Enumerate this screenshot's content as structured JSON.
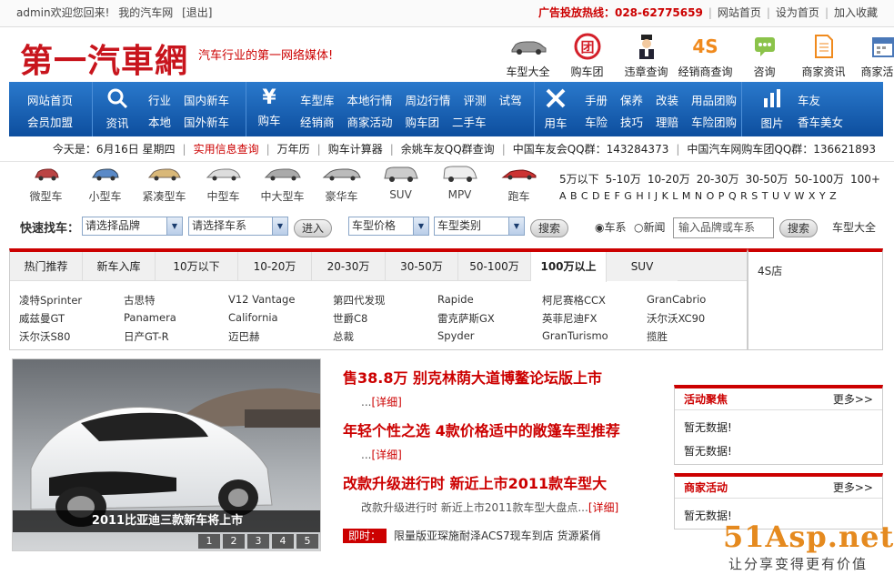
{
  "topbar": {
    "welcome": "admin欢迎您回来!",
    "my_site": "我的汽车网",
    "logout": "[退出]",
    "ad_hotline": "广告投放热线：028-62775659",
    "links": [
      "网站首页",
      "设为首页",
      "加入收藏"
    ]
  },
  "header": {
    "logo": "第一汽車網",
    "slogan": "汽车行业的第一网络媒体!"
  },
  "quick_icons": [
    {
      "label": "车型大全",
      "icon": "car-icon"
    },
    {
      "label": "购车团",
      "icon": "group-buy-icon"
    },
    {
      "label": "违章查询",
      "icon": "police-icon"
    },
    {
      "label": "经销商查询",
      "icon": "4s-icon"
    },
    {
      "label": "咨询",
      "icon": "chat-icon"
    },
    {
      "label": "商家资讯",
      "icon": "document-icon"
    },
    {
      "label": "商家活动",
      "icon": "calendar-icon"
    }
  ],
  "nav": {
    "home": {
      "row1": "网站首页",
      "row2": "会员加盟"
    },
    "info": {
      "label": "资讯",
      "icon": "search-icon",
      "row1": [
        "行业",
        "国内新车"
      ],
      "row2": [
        "本地",
        "国外新车"
      ]
    },
    "buy": {
      "label": "购车",
      "icon": "yen-icon",
      "row1": [
        "车型库",
        "本地行情",
        "周边行情",
        "评测",
        "试驾"
      ],
      "row2": [
        "经销商",
        "商家活动",
        "购车团",
        "二手车"
      ]
    },
    "use": {
      "label": "用车",
      "icon": "tools-icon",
      "row1": [
        "手册",
        "保养",
        "改装",
        "用品团购"
      ],
      "row2": [
        "车险",
        "技巧",
        "理赔",
        "车险团购"
      ]
    },
    "pics": {
      "label": "图片",
      "icon": "bar-chart-icon",
      "row1": [
        "车友"
      ],
      "row2": [
        "香车美女"
      ]
    }
  },
  "infobar": {
    "date": "今天是：6月16日 星期四",
    "items": [
      "实用信息查询",
      "万年历",
      "购车计算器",
      "余姚车友QQ群查询",
      "中国车友会QQ群：143284373",
      "中国汽车网购车团QQ群：136621893"
    ]
  },
  "car_types": [
    "微型车",
    "小型车",
    "紧凑型车",
    "中型车",
    "中大型车",
    "豪华车",
    "SUV",
    "MPV",
    "跑车"
  ],
  "price_ranges": [
    "5万以下",
    "5-10万",
    "10-20万",
    "20-30万",
    "30-50万",
    "50-100万",
    "100+"
  ],
  "letters": "ABCDEFGHIJKLMNOPQRSTUVWXYZ",
  "finder": {
    "label": "快速找车：",
    "brand": "请选择品牌",
    "series": "请选择车系",
    "enter": "进入",
    "price": "车型价格",
    "category": "车型类别",
    "search": "搜索",
    "radio_car": "车系",
    "radio_news": "新闻",
    "keyword_placeholder": "输入品牌或车系",
    "search2": "搜索",
    "all": "车型大全"
  },
  "tabs": [
    "热门推荐",
    "新车入库",
    "10万以下",
    "10-20万",
    "20-30万",
    "30-50万",
    "50-100万",
    "100万以上",
    "SUV"
  ],
  "models": [
    [
      "凌特Sprinter",
      "威兹曼GT",
      "沃尔沃S80"
    ],
    [
      "古思特",
      "Panamera",
      "日产GT-R"
    ],
    [
      "V12 Vantage",
      "California",
      "迈巴赫"
    ],
    [
      "第四代发现",
      "世爵C8",
      "总裁"
    ],
    [
      "Rapide",
      "雷克萨斯GX",
      "Spyder"
    ],
    [
      "柯尼赛格CCX",
      "英菲尼迪FX",
      "GranTurismo"
    ],
    [
      "GranCabrio",
      "沃尔沃XC90",
      "揽胜"
    ]
  ],
  "side4s": "4S店",
  "hero": {
    "caption": "2011比亚迪三款新车将上市",
    "pages": [
      "1",
      "2",
      "3",
      "4",
      "5"
    ]
  },
  "news": [
    {
      "title": "售38.8万  别克林荫大道博鳌论坛版上市",
      "sub": "...",
      "detail": "[详细]"
    },
    {
      "title": "年轻个性之选  4款价格适中的敞篷车型推荐",
      "sub": "...",
      "detail": "[详细]"
    },
    {
      "title": "改款升级进行时  新近上市2011款车型大",
      "sub": "改款升级进行时 新近上市2011款车型大盘点...",
      "detail": "[详细]"
    }
  ],
  "flash": {
    "tag": "即时：",
    "text": "限量版亚琛施耐泽ACS7现车到店 货源紧俏"
  },
  "panel_events": {
    "title": "活动聚焦",
    "more": "更多>>",
    "lines": [
      "暂无数据!",
      "暂无数据!"
    ]
  },
  "panel_biz": {
    "title": "商家活动",
    "more": "更多>>",
    "lines": [
      "暂无数据!"
    ]
  },
  "watermark": {
    "big": "51Asp.net",
    "small": "让分享变得更有价值"
  },
  "colors": {
    "brand_red": "#c8151d",
    "nav_blue": "#0d4e9e",
    "accent_orange": "#e58a1f"
  }
}
